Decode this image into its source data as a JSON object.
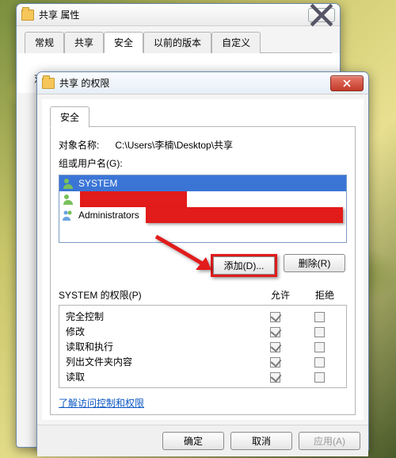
{
  "win1": {
    "title": "共享 属性",
    "tabs": [
      "常规",
      "共享",
      "安全",
      "以前的版本",
      "自定义"
    ],
    "active_tab_index": 2,
    "object_label": "对象名称:"
  },
  "win2": {
    "title": "共享 的权限",
    "tab": "安全",
    "object_label": "对象名称:",
    "object_path": "C:\\Users\\李楠\\Desktop\\共享",
    "group_label": "组或用户名(G):",
    "users": [
      {
        "name": "SYSTEM",
        "selected": true,
        "redacted": false
      },
      {
        "name": "",
        "selected": false,
        "redacted": true
      },
      {
        "name": "Administrators",
        "selected": false,
        "redacted": true
      }
    ],
    "add_label": "添加(D)...",
    "remove_label": "删除(R)",
    "perm_for_label": "SYSTEM 的权限(P)",
    "perm_header_allow": "允许",
    "perm_header_deny": "拒绝",
    "permissions": [
      {
        "name": "完全控制",
        "allow": true,
        "deny": false
      },
      {
        "name": "修改",
        "allow": true,
        "deny": false
      },
      {
        "name": "读取和执行",
        "allow": true,
        "deny": false
      },
      {
        "name": "列出文件夹内容",
        "allow": true,
        "deny": false
      },
      {
        "name": "读取",
        "allow": true,
        "deny": false
      }
    ],
    "link_text": "了解访问控制和权限",
    "ok_label": "确定",
    "cancel_label": "取消",
    "apply_label": "应用(A)"
  }
}
